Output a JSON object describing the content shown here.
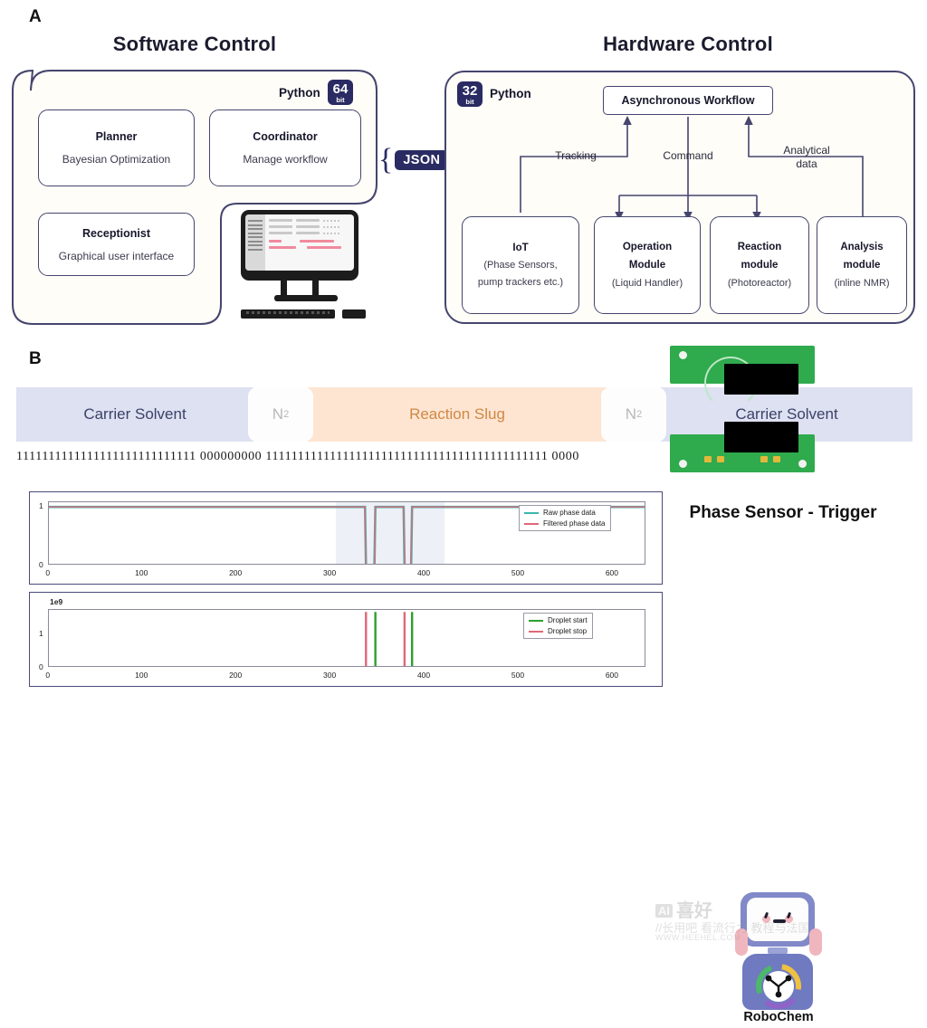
{
  "figure": {
    "panel_a_letter": "A",
    "panel_b_letter": "B"
  },
  "panel_a": {
    "software": {
      "title": "Software Control",
      "python_label": "Python",
      "bit_number": "64",
      "bit_word": "bit",
      "boxes": [
        {
          "title": "Planner",
          "subtitle": "Bayesian Optimization"
        },
        {
          "title": "Coordinator",
          "subtitle": "Manage workflow"
        },
        {
          "title": "Receptionist",
          "subtitle": "Graphical user interface"
        }
      ],
      "monitor_icon": "desktop-computer-icon"
    },
    "connector": {
      "left_brace": "{",
      "label": "JSON",
      "right_brace": "}"
    },
    "hardware": {
      "title": "Hardware Control",
      "python_label": "Python",
      "bit_number": "32",
      "bit_word": "bit",
      "workflow_box": "Asynchronous Workflow",
      "edges": [
        {
          "label": "Tracking"
        },
        {
          "label": "Command"
        },
        {
          "label": "Analytical\ndata"
        }
      ],
      "edge_tracking": "Tracking",
      "edge_command": "Command",
      "edge_analytical_l1": "Analytical",
      "edge_analytical_l2": "data",
      "modules": [
        {
          "l1": "IoT",
          "l2": "(Phase Sensors,",
          "l3": "pump trackers etc.)"
        },
        {
          "l1": "Operation",
          "l2": "Module",
          "l3": "(Liquid Handler)"
        },
        {
          "l1": "Reaction",
          "l2": "module",
          "l3": "(Photoreactor)"
        },
        {
          "l1": "Analysis",
          "l2": "module",
          "l3": "(inline NMR)"
        }
      ]
    }
  },
  "panel_b": {
    "slug_segments": [
      {
        "label": "Carrier Solvent",
        "type": "carrier"
      },
      {
        "label": "N",
        "sub": "2",
        "type": "n2"
      },
      {
        "label": "Reaction Slug",
        "type": "slug"
      },
      {
        "label": "N",
        "sub": "2",
        "type": "n2"
      },
      {
        "label": "Carrier Solvent",
        "type": "carrier"
      }
    ],
    "bitstring": "1111111111111111111111111111 000000000 11111111111111111111111111111111111111111111 0000",
    "sensor_caption": "Phase Sensor - Trigger",
    "pcb_icon": "phase-sensor-pcb-icon",
    "robochem": {
      "name": "RoboChem",
      "icon": "robochem-robot-logo"
    },
    "watermark": {
      "badge": "AI",
      "line1": "喜好",
      "line2": "//长用吧 看流行力 教程与法国",
      "line3": "WWW.HEEHEL.COM"
    },
    "colors": {
      "carrier": "#dde1f1",
      "carrier_text": "#3d4168",
      "slug": "#fde5d2",
      "slug_text": "#d08844",
      "n2": "#fdfdfd",
      "n2_text": "#b8b8b8",
      "pcb_green": "#2faa4d",
      "accent_navy": "#2b2b63"
    }
  },
  "chart_data": [
    {
      "type": "line",
      "title": "",
      "xlabel": "",
      "ylabel": "",
      "xlim": [
        0,
        635
      ],
      "ylim": [
        0,
        1.08
      ],
      "xticks": [
        0,
        100,
        200,
        300,
        400,
        500,
        600
      ],
      "yticks": [
        0,
        1
      ],
      "grid": false,
      "legend_position": "upper right",
      "shaded_region": {
        "x0": 305,
        "x1": 420,
        "color": "#e8ebf4"
      },
      "series": [
        {
          "name": "Raw phase data",
          "color": "#3bb5ad",
          "x": [
            0,
            336,
            337,
            346,
            347,
            377,
            378,
            385,
            386,
            635
          ],
          "values": [
            1,
            1,
            0,
            0,
            1,
            1,
            0,
            0,
            1,
            1
          ]
        },
        {
          "name": "Filtered phase data",
          "color": "#e06878",
          "x": [
            0,
            336,
            337,
            346,
            347,
            377,
            378,
            385,
            386,
            635
          ],
          "values": [
            1,
            1,
            0,
            0,
            1,
            1,
            0,
            0,
            1,
            1
          ]
        }
      ]
    },
    {
      "type": "line",
      "title": "",
      "xlabel": "",
      "ylabel": "",
      "y_offset_label": "1e9",
      "xlim": [
        0,
        635
      ],
      "ylim": [
        0,
        1.72
      ],
      "xticks": [
        0,
        100,
        200,
        300,
        400,
        500,
        600
      ],
      "yticks": [
        0,
        1
      ],
      "grid": false,
      "legend_position": "upper right",
      "series": [
        {
          "name": "Droplet start",
          "color": "#2ca02c",
          "spikes": [
            347,
            386
          ],
          "spike_height": 1.66,
          "baseline": 0.02
        },
        {
          "name": "Droplet stop",
          "color": "#e06878",
          "spikes": [
            337,
            378
          ],
          "spike_height": 1.66,
          "baseline": 0.02
        }
      ]
    }
  ]
}
